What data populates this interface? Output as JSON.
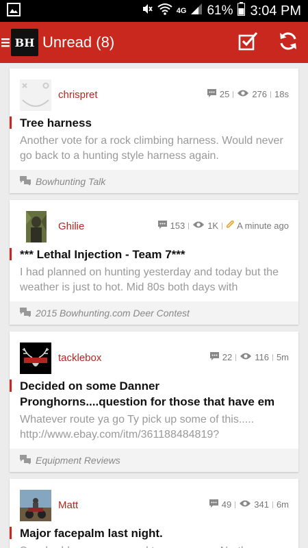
{
  "status_bar": {
    "network": "4G",
    "battery": "61%",
    "time": "3:04 PM"
  },
  "app_bar": {
    "logo_text": "BH",
    "title": "Unread (8)",
    "mark_read_icon": "checkbox-check-icon",
    "refresh_icon": "refresh-icon"
  },
  "colors": {
    "brand_red": "#c8281e",
    "author_red": "#b3261e",
    "muted_text": "#999999"
  },
  "threads": [
    {
      "author": "chrispret",
      "replies": "25",
      "views": "276",
      "time": "18s",
      "title": "Tree harness",
      "preview": "Another vote for a rock climbing harness. Would never go back to a hunting style harness again.",
      "forum": "Bowhunting Talk"
    },
    {
      "author": "Ghilie",
      "replies": "153",
      "views": "1K",
      "time": "A minute ago",
      "title": "*** Lethal Injection - Team 7***",
      "preview": "I had planned on hunting yesterday and today but the weather is just to hot. Mid 80s both days with",
      "forum": "2015 Bowhunting.com Deer Contest"
    },
    {
      "author": "tacklebox",
      "replies": "22",
      "views": "116",
      "time": "5m",
      "title": "Decided on some Danner Pronghorns....question for those that have em",
      "preview": "Whatever route ya go Ty pick up some of this..... http://www.ebay.com/itm/361188484819?",
      "forum": "Equipment Reviews"
    },
    {
      "author": "Matt",
      "replies": "49",
      "views": "341",
      "time": "6m",
      "title": "Major facepalm last night.",
      "preview": "So a buddy was supposed to come over. Northern",
      "forum": ""
    }
  ]
}
